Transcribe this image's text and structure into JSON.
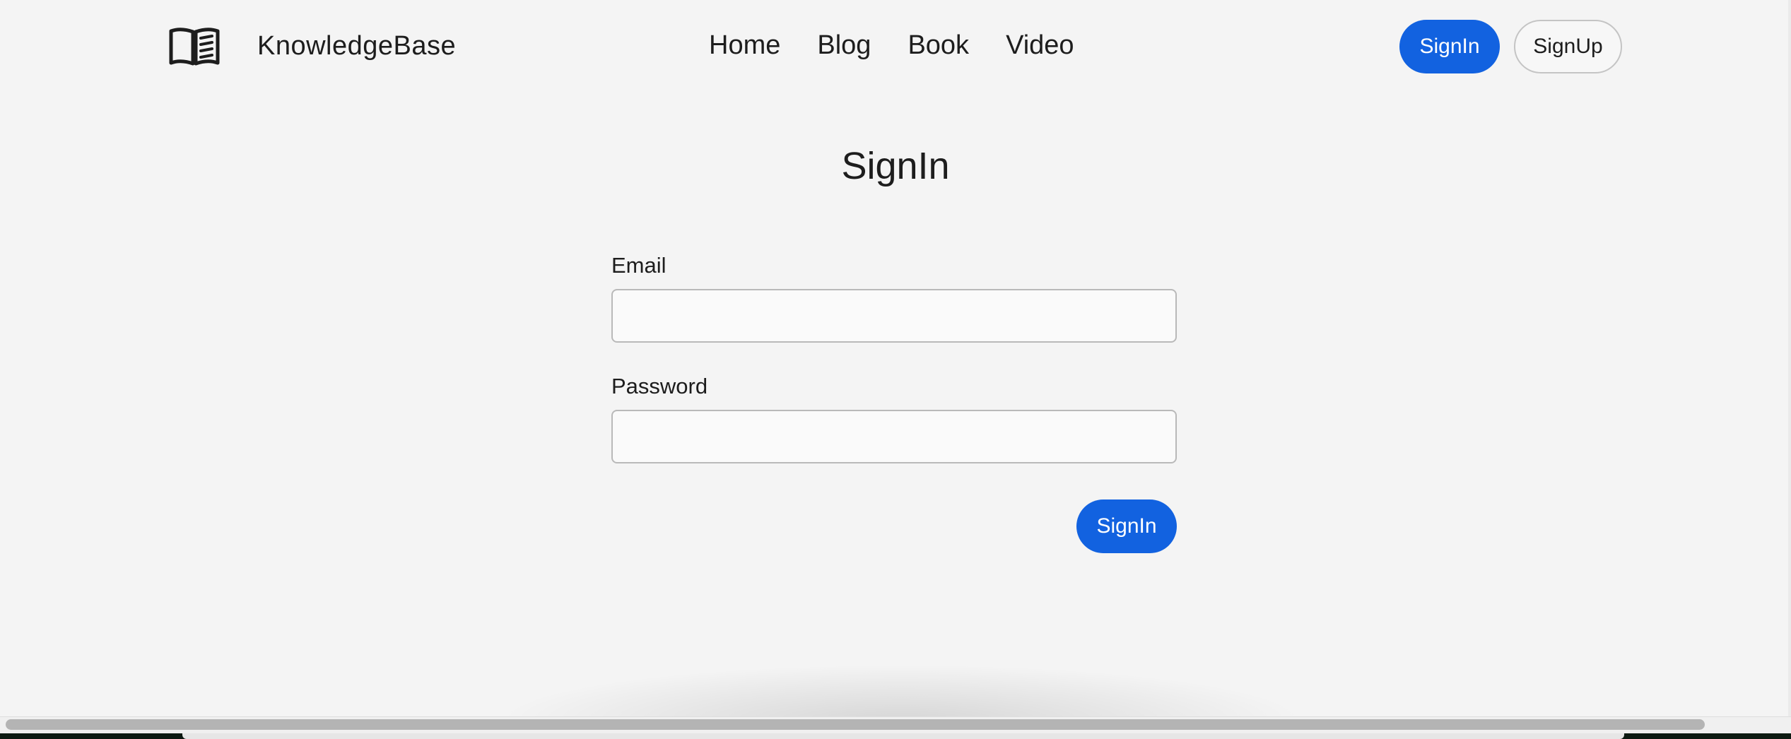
{
  "header": {
    "brand": "KnowledgeBase",
    "logo_icon": "open-book-icon",
    "nav": [
      "Home",
      "Blog",
      "Book",
      "Video"
    ],
    "signin_label": "SignIn",
    "signup_label": "SignUp"
  },
  "form": {
    "title": "SignIn",
    "email_label": "Email",
    "email_value": "",
    "password_label": "Password",
    "password_value": "",
    "submit_label": "SignIn"
  },
  "colors": {
    "primary": "#1262e0",
    "background": "#f4f4f4",
    "text": "#1d1d1d"
  }
}
